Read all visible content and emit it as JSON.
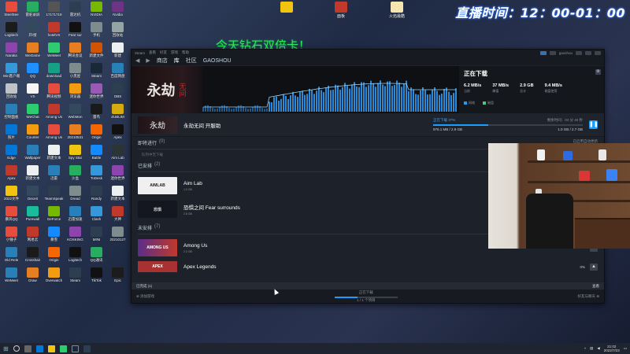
{
  "live": {
    "clock": "直播时间：12：00-01：00"
  },
  "promo": {
    "text": "今天钻石双倍卡！"
  },
  "colors": {
    "steam_accent": "#1a9fff",
    "promo_green": "#32e85c",
    "clock_glow": "#3377ff"
  },
  "desktop_top_icons": [
    {
      "label": "",
      "icon": "yellow-app-icon",
      "color": "#f1c40f"
    },
    {
      "label": "面板",
      "icon": "red-folder-icon",
      "color": "#c0392b"
    },
    {
      "label": "火焰最酷",
      "icon": "document-icon",
      "color": "#f5e6b0"
    }
  ],
  "desktop_icons": [
    {
      "label": "SteelSee",
      "color": "#e74c3c"
    },
    {
      "label": "雷蛇录屏",
      "color": "#27ae60"
    },
    {
      "label": "17171719",
      "color": "#555"
    },
    {
      "label": "雷达机",
      "color": "#2c3e50"
    },
    {
      "label": "NVIDIA",
      "color": "#76b900"
    },
    {
      "label": "Nvidia",
      "color": "#6c3483"
    },
    {
      "label": "Logitech",
      "color": "#1c1c1c"
    },
    {
      "label": "开/接",
      "color": "#34495e"
    },
    {
      "label": "hotelVS",
      "color": "#c0392b"
    },
    {
      "label": "Fear sur",
      "color": "#111"
    },
    {
      "label": "手机",
      "color": "#7f8c8d"
    },
    {
      "label": "回收站",
      "color": "#95a5a6"
    },
    {
      "label": "Naraka",
      "color": "#8e44ad"
    },
    {
      "label": "WeGame",
      "color": "#e67e22"
    },
    {
      "label": "WeMeet",
      "color": "#2ecc71"
    },
    {
      "label": "腾讯会议",
      "color": "#e67e22"
    },
    {
      "label": "新建文件",
      "color": "#d35400"
    },
    {
      "label": "新建",
      "color": "#ecf0f1"
    },
    {
      "label": "Win客户端",
      "color": "#3498db"
    },
    {
      "label": "QQ",
      "color": "#1e90ff"
    },
    {
      "label": "download",
      "color": "#16a085"
    },
    {
      "label": "小黑屋",
      "color": "#7f8c8d"
    },
    {
      "label": "Steam",
      "color": "#1b2838"
    },
    {
      "label": "百度网盘",
      "color": "#2980b9"
    },
    {
      "label": "回收站",
      "color": "#bdc3c7"
    },
    {
      "label": "VS",
      "color": "#f5f5f5"
    },
    {
      "label": "腾讯视频",
      "color": "#e74c3c"
    },
    {
      "label": "浏览器",
      "color": "#f39c12"
    },
    {
      "label": "迷你世界",
      "color": "#9b59b6"
    },
    {
      "label": "OBS",
      "color": "#2c3e50"
    },
    {
      "label": "控制面板",
      "color": "#2980b9"
    },
    {
      "label": "WeChat",
      "color": "#2ecc71"
    },
    {
      "label": "Among Us",
      "color": "#c0392b"
    },
    {
      "label": "WebMon",
      "color": "#34495e"
    },
    {
      "label": "雷鸟",
      "color": "#1a1a1a"
    },
    {
      "label": "ZUBLIM",
      "color": "#d4ac0d"
    },
    {
      "label": "照片",
      "color": "#0078d7"
    },
    {
      "label": "Counter",
      "color": "#f39c12"
    },
    {
      "label": "Among Us",
      "color": "#e74c3c"
    },
    {
      "label": "20210531",
      "color": "#e67e22"
    },
    {
      "label": "Origin",
      "color": "#f56600"
    },
    {
      "label": "Apex",
      "color": "#111"
    },
    {
      "label": "Edge",
      "color": "#0078d7"
    },
    {
      "label": "Wallpaper",
      "color": "#2980b9"
    },
    {
      "label": "新建文本",
      "color": "#ecf0f1"
    },
    {
      "label": "Spy Star",
      "color": "#f1c40f"
    },
    {
      "label": "Battle",
      "color": "#148aff"
    },
    {
      "label": "Aim Lab",
      "color": "#2d3436"
    },
    {
      "label": "Apex",
      "color": "#c0392b"
    },
    {
      "label": "新建文本",
      "color": "#ecf0f1"
    },
    {
      "label": "迅雷",
      "color": "#2980b9"
    },
    {
      "label": "沙盒",
      "color": "#27ae60"
    },
    {
      "label": "ToDesk",
      "color": "#3498db"
    },
    {
      "label": "迷你世界",
      "color": "#8e44ad"
    },
    {
      "label": "2022文件",
      "color": "#f1c40f"
    },
    {
      "label": "Deceit",
      "color": "#34495e"
    },
    {
      "label": "TeamSpeak",
      "color": "#2c3e50"
    },
    {
      "label": "Dread",
      "color": "#7f8c8d"
    },
    {
      "label": "Randy",
      "color": "#2c3e50"
    },
    {
      "label": "新建文本",
      "color": "#ecf0f1"
    },
    {
      "label": "暴风QQ",
      "color": "#e74c3c"
    },
    {
      "label": "Purewall",
      "color": "#1abc9c"
    },
    {
      "label": "GeForce",
      "color": "#76b900"
    },
    {
      "label": "迅雷加速",
      "color": "#2980b9"
    },
    {
      "label": "Clash",
      "color": "#3498db"
    },
    {
      "label": "大神",
      "color": "#c0392b"
    },
    {
      "label": "小锤子",
      "color": "#e74c3c"
    },
    {
      "label": "网易云",
      "color": "#c0392b"
    },
    {
      "label": "暴雪",
      "color": "#148aff"
    },
    {
      "label": "KOSKING",
      "color": "#8e44ad"
    },
    {
      "label": "MINI",
      "color": "#2c3e50"
    },
    {
      "label": "20210127",
      "color": "#7f8c8d"
    },
    {
      "label": "Old Rele",
      "color": "#2980b9"
    },
    {
      "label": "Crosshair",
      "color": "#1a1a1a"
    },
    {
      "label": "Origin",
      "color": "#f56600"
    },
    {
      "label": "Logitech",
      "color": "#111"
    },
    {
      "label": "QQ通讯",
      "color": "#27ae60"
    },
    {
      "label": "",
      "color": "transparent"
    },
    {
      "label": "WeMeet",
      "color": "#2980b9"
    },
    {
      "label": "Draw",
      "color": "#e67e22"
    },
    {
      "label": "Overwatch",
      "color": "#f39c12"
    },
    {
      "label": "Steam",
      "color": "#2c3e50"
    },
    {
      "label": "TikTok",
      "color": "#111"
    },
    {
      "label": "Epic",
      "color": "#1c1c1c"
    }
  ],
  "steam": {
    "titlebar": {
      "left": [
        "Steam",
        "查看",
        "好友",
        "游戏",
        "帮助"
      ],
      "user": "gaoshou"
    },
    "nav": {
      "tabs": [
        "商店",
        "库",
        "社区",
        "GAOSHOU"
      ]
    },
    "hero": {
      "art_title": "永劫",
      "art_sub": "无间",
      "panel_title": "正在下载",
      "stats": [
        {
          "value": "6.2 MB/s",
          "key": "当前"
        },
        {
          "value": "37 MB/s",
          "key": "峰值"
        },
        {
          "value": "2.9 GB",
          "key": "总计"
        },
        {
          "value": "9.4 MB/s",
          "key": "磁盘使用"
        }
      ],
      "legend": [
        {
          "label": "网络",
          "color": "#1a9fff"
        },
        {
          "label": "磁盘",
          "color": "#56c47a"
        }
      ],
      "menu_icon": "settings-icon"
    },
    "current": {
      "name": "永劫无间 开服助",
      "thumb_text": "永劫",
      "progress_label": "正在下载 37%",
      "progress": 37,
      "remaining": "剩余时间：04 分 40 秒",
      "downloaded": "976.1 MB / 2.9 GB",
      "size_right": "1.0 GB / 2.7 GB"
    },
    "sections": {
      "upcoming": {
        "title": "即将进行",
        "count": "(0)",
        "empty": "队列中无下载",
        "right": "已启用自动更新"
      },
      "scheduled": {
        "title": "已安排",
        "count": "(2)",
        "games": [
          {
            "name": "Aim Lab",
            "size": "1.0 GB",
            "thumb": "AIMLAB"
          },
          {
            "name": "恐惧之间 Fear surrounds",
            "size": "2.8 GB",
            "thumb": "恐惧"
          }
        ]
      },
      "unscheduled": {
        "title": "未安排",
        "count": "(7)",
        "games": [
          {
            "name": "Among Us",
            "size": "2.3 GB",
            "thumb": "AMONG US",
            "pct": ""
          },
          {
            "name": "Apex Legends",
            "size": "",
            "thumb": "APEX",
            "pct": "0%"
          }
        ]
      }
    },
    "footer": {
      "top_left": "已完成 (1)",
      "top_right": "查看",
      "manage": "添加游戏",
      "status": "正在下载",
      "status_detail": "1 / 1 个项目",
      "friends": "好友与聊天"
    }
  },
  "taskbar": {
    "time": "21:02",
    "date": "2022/7/23"
  }
}
